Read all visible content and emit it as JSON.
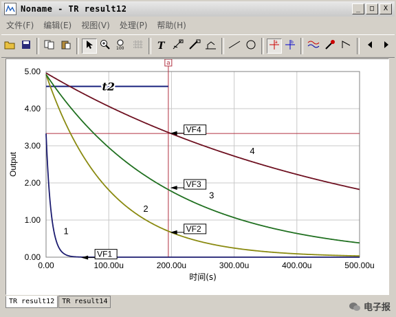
{
  "window": {
    "title": "Noname - TR result12",
    "buttons": [
      "_",
      "□",
      "X"
    ]
  },
  "menu": [
    {
      "label": "文件(F)"
    },
    {
      "label": "编辑(E)"
    },
    {
      "label": "视图(V)"
    },
    {
      "label": "处理(P)"
    },
    {
      "label": "帮助(H)"
    }
  ],
  "toolbar": {
    "tools": [
      {
        "name": "open-folder-icon"
      },
      {
        "name": "save-icon"
      },
      {
        "name": "copy-icon"
      },
      {
        "name": "paste-icon"
      },
      {
        "name": "pointer-icon",
        "pressed": true
      },
      {
        "name": "zoom-in-icon"
      },
      {
        "name": "zoom-100-icon"
      },
      {
        "name": "grid-icon"
      },
      {
        "name": "text-icon"
      },
      {
        "name": "arrow-annotation-icon"
      },
      {
        "name": "pen-annotation-icon"
      },
      {
        "name": "axis-annotation-icon"
      },
      {
        "name": "line-icon"
      },
      {
        "name": "circle-icon"
      },
      {
        "name": "cursor-a-icon",
        "pressed": true
      },
      {
        "name": "cursor-b-icon"
      },
      {
        "name": "waveform-icon"
      },
      {
        "name": "probe-icon"
      },
      {
        "name": "step-icon"
      },
      {
        "name": "scroll-left-icon"
      },
      {
        "name": "scroll-right-icon"
      }
    ]
  },
  "tabs": [
    {
      "label": "TR result12",
      "active": true
    },
    {
      "label": "TR result14",
      "active": false
    }
  ],
  "watermark": {
    "text": "电子报"
  },
  "chart_data": {
    "type": "line",
    "xlabel": "时间(s)",
    "ylabel": "Output",
    "xlim": [
      0,
      500
    ],
    "ylim": [
      0,
      5
    ],
    "x_ticks": [
      "0.00",
      "100.00u",
      "200.00u",
      "300.00u",
      "400.00u",
      "500.00u"
    ],
    "y_ticks": [
      "0.00",
      "1.00",
      "2.00",
      "3.00",
      "4.00",
      "5.00"
    ],
    "grid": true,
    "series": [
      {
        "name": "1",
        "color": "#1b1b6f",
        "v0": 3.33,
        "tau": 8,
        "tstart": 0
      },
      {
        "name": "2",
        "color": "#8a8a10",
        "v0": 4.92,
        "tau": 100,
        "tstart": 0
      },
      {
        "name": "3",
        "color": "#207020",
        "v0": 4.92,
        "tau": 196,
        "tstart": 0
      },
      {
        "name": "4",
        "color": "#6e1020",
        "v0": 4.96,
        "tau": 500,
        "tstart": 0
      }
    ],
    "labels": [
      {
        "text": "1",
        "x": 28,
        "y": 0.62
      },
      {
        "text": "2",
        "x": 155,
        "y": 1.22
      },
      {
        "text": "3",
        "x": 260,
        "y": 1.58
      },
      {
        "text": "4",
        "x": 325,
        "y": 2.78
      }
    ],
    "flags": [
      {
        "text": "VF1",
        "x": 78,
        "y": 0.1
      },
      {
        "text": "VF2",
        "x": 220,
        "y": 0.78
      },
      {
        "text": "VF3",
        "x": 220,
        "y": 1.98
      },
      {
        "text": "VF4",
        "x": 220,
        "y": 3.45
      }
    ],
    "annotation": {
      "text": "t2",
      "x": 85,
      "y": 4.6
    },
    "cursor": {
      "label": "a",
      "x": 195,
      "y": 3.33
    }
  }
}
